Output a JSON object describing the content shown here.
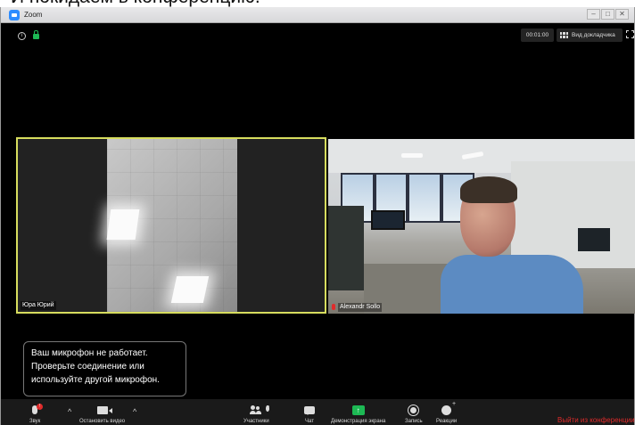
{
  "caption": {
    "text": "И покидаем в конференцию."
  },
  "window": {
    "title": "Zoom",
    "controls": {
      "minimize": "–",
      "maximize": "□",
      "close": "✕"
    }
  },
  "topbar": {
    "timer": "00:01:00",
    "view_label": "Вид докладчика",
    "icons": [
      "info-icon",
      "lock-icon",
      "grid-icon",
      "fullscreen-icon"
    ],
    "lock_color": "#1db954"
  },
  "videos": [
    {
      "name": "Юра Юрий",
      "active_speaker": true,
      "border_color": "#d7dd5e"
    },
    {
      "name": "Alexandr Sollo",
      "muted": true
    }
  ],
  "mic_warning": {
    "lines": [
      "Ваш микрофон не работает.",
      "Проверьте соединение или",
      "используйте другой микрофон."
    ]
  },
  "toolbar": {
    "audio": {
      "label": "Звук",
      "badge": "!"
    },
    "video": {
      "label": "Остановить видео"
    },
    "participants": {
      "label": "Участники",
      "count": "2"
    },
    "chat": {
      "label": "Чат"
    },
    "share": {
      "label": "Демонстрация экрана",
      "color": "#1db954"
    },
    "record": {
      "label": "Запись"
    },
    "reactions": {
      "label": "Реакции"
    },
    "leave": {
      "label": "Выйти из конференции",
      "color": "#e02b2b"
    },
    "caret": "^"
  }
}
